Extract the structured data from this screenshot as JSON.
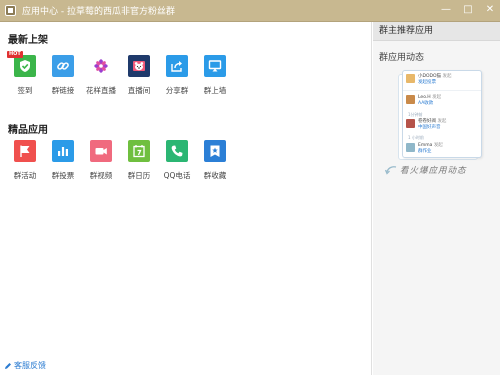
{
  "window": {
    "title": "应用中心 - 拉草莓的西瓜非官方粉丝群",
    "buttons": [
      "—",
      "□",
      "✕"
    ]
  },
  "latest": {
    "title": "最新上架",
    "hot_badge": "HOT",
    "apps": [
      {
        "label": "签到",
        "icon": "checkin-icon",
        "color": "#3bb54a"
      },
      {
        "label": "群链接",
        "icon": "link-icon",
        "color": "#3b9ee8"
      },
      {
        "label": "花样直播",
        "icon": "flower-icon",
        "color": "#ffffff"
      },
      {
        "label": "直播间",
        "icon": "tv-bear-icon",
        "color": "#1f3a6b"
      },
      {
        "label": "分享群",
        "icon": "share-icon",
        "color": "#2b9be8"
      },
      {
        "label": "群上墙",
        "icon": "screen-icon",
        "color": "#2b9be8"
      }
    ]
  },
  "featured": {
    "title": "精品应用",
    "apps": [
      {
        "label": "群活动",
        "icon": "flag-icon",
        "color": "#f0504e"
      },
      {
        "label": "群投票",
        "icon": "bar-chart-icon",
        "color": "#2b9be8"
      },
      {
        "label": "群视频",
        "icon": "video-icon",
        "color": "#f06a7e"
      },
      {
        "label": "群日历",
        "icon": "calendar-icon",
        "color": "#6fbf3f"
      },
      {
        "label": "QQ电话",
        "icon": "phone-icon",
        "color": "#2bb673"
      },
      {
        "label": "群收藏",
        "icon": "star-bookmark-icon",
        "color": "#2b7fd6"
      }
    ]
  },
  "feedback": "客服反馈",
  "sidebar": {
    "header": "群主推荐应用",
    "subheader": "群应用动态",
    "feed": [
      {
        "user": "小DODO猫",
        "suffix": "发起",
        "action": "发起投票",
        "color": "#e8b86a"
      },
      {
        "user": "Leo.H",
        "suffix": "发起",
        "action": "AA收款",
        "color": "#c98a4a",
        "time": "1分钟前"
      },
      {
        "user": "卷卷好阅",
        "suffix": "发起",
        "action": "中国好声音",
        "color": "#b5534a",
        "time": "1 小时前"
      },
      {
        "user": "Emma",
        "suffix": "发起",
        "action": "群作业",
        "color": "#8fb7c9"
      }
    ],
    "caption": "看火爆应用动态"
  }
}
